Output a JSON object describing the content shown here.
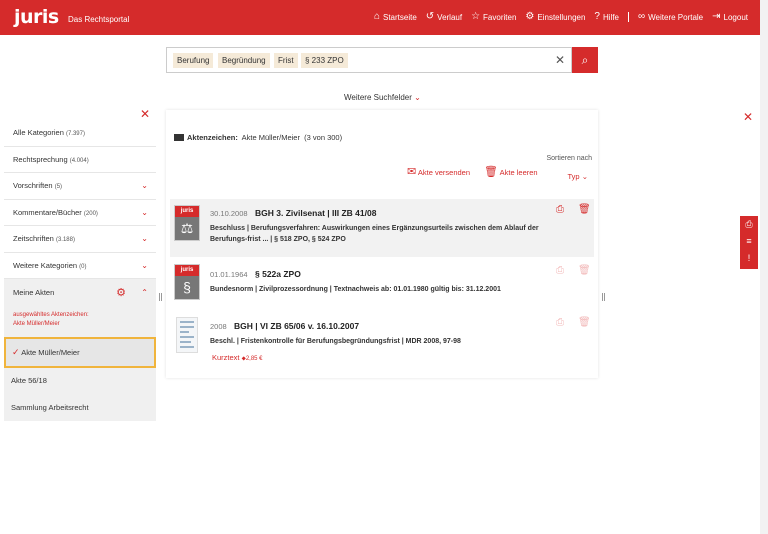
{
  "header": {
    "logo": "juris",
    "tagline": "Das Rechtsportal",
    "nav": [
      {
        "label": "Startseite",
        "icon": "home-icon"
      },
      {
        "label": "Verlauf",
        "icon": "history-icon"
      },
      {
        "label": "Favoriten",
        "icon": "star-icon"
      },
      {
        "label": "Einstellungen",
        "icon": "gear-icon"
      },
      {
        "label": "Hilfe",
        "icon": "help-icon"
      },
      {
        "label": "Weitere Portale",
        "icon": "link-icon"
      },
      {
        "label": "Logout",
        "icon": "logout-icon"
      }
    ]
  },
  "search": {
    "chips": [
      "Berufung",
      "Begründung",
      "Frist",
      "§ 233 ZPO"
    ],
    "more_filters": "Weitere Suchfelder"
  },
  "sidebar": {
    "categories": [
      {
        "label": "Alle Kategorien",
        "count": "(7.397)"
      },
      {
        "label": "Rechtsprechung",
        "count": "(4.004)"
      },
      {
        "label": "Vorschriften",
        "count": "(5)"
      },
      {
        "label": "Kommentare/Bücher",
        "count": "(200)"
      },
      {
        "label": "Zeitschriften",
        "count": "(3.188)"
      },
      {
        "label": "Weitere Kategorien",
        "count": "(0)"
      }
    ],
    "akten": {
      "title": "Meine Akten",
      "selected_label": "ausgewähltes Aktenzeichen:",
      "selected_value": "Akte Müller/Meier",
      "active": "Akte Müller/Meier",
      "items": [
        "Akte 56/18",
        "Sammlung Arbeitsrecht"
      ]
    }
  },
  "main": {
    "aktenzeichen_label": "Aktenzeichen:",
    "aktenzeichen_value": "Akte Müller/Meier",
    "aktenzeichen_count": "(3 von 300)",
    "send": "Akte versenden",
    "clear": "Akte leeren",
    "sort_label": "Sortieren nach",
    "sort_value": "Typ",
    "results": [
      {
        "date": "30.10.2008",
        "title": "BGH 3. Zivilsenat | III ZB 41/08",
        "desc": "Beschluss | Berufungsverfahren: Auswirkungen eines Ergänzungsurteils zwischen dem Ablauf der Berufungs-frist ... | § 518 ZPO, § 524 ZPO",
        "thumb_label": "juris"
      },
      {
        "date": "01.01.1964",
        "title": "§ 522a ZPO",
        "desc": "Bundesnorm | Zivilprozessordnung | Textnachweis ab: 01.01.1980 gültig bis: 31.12.2001",
        "thumb_label": "juris",
        "thumb_symbol": "§"
      },
      {
        "date": "2008",
        "title": "BGH | VI ZB 65/06 v. 16.10.2007",
        "desc": "Beschl. | Fristenkontrolle für Berufungsbegründungsfrist | MDR 2008, 97-98",
        "kurztext": "Kurztext",
        "price": "2,85 €"
      }
    ]
  }
}
